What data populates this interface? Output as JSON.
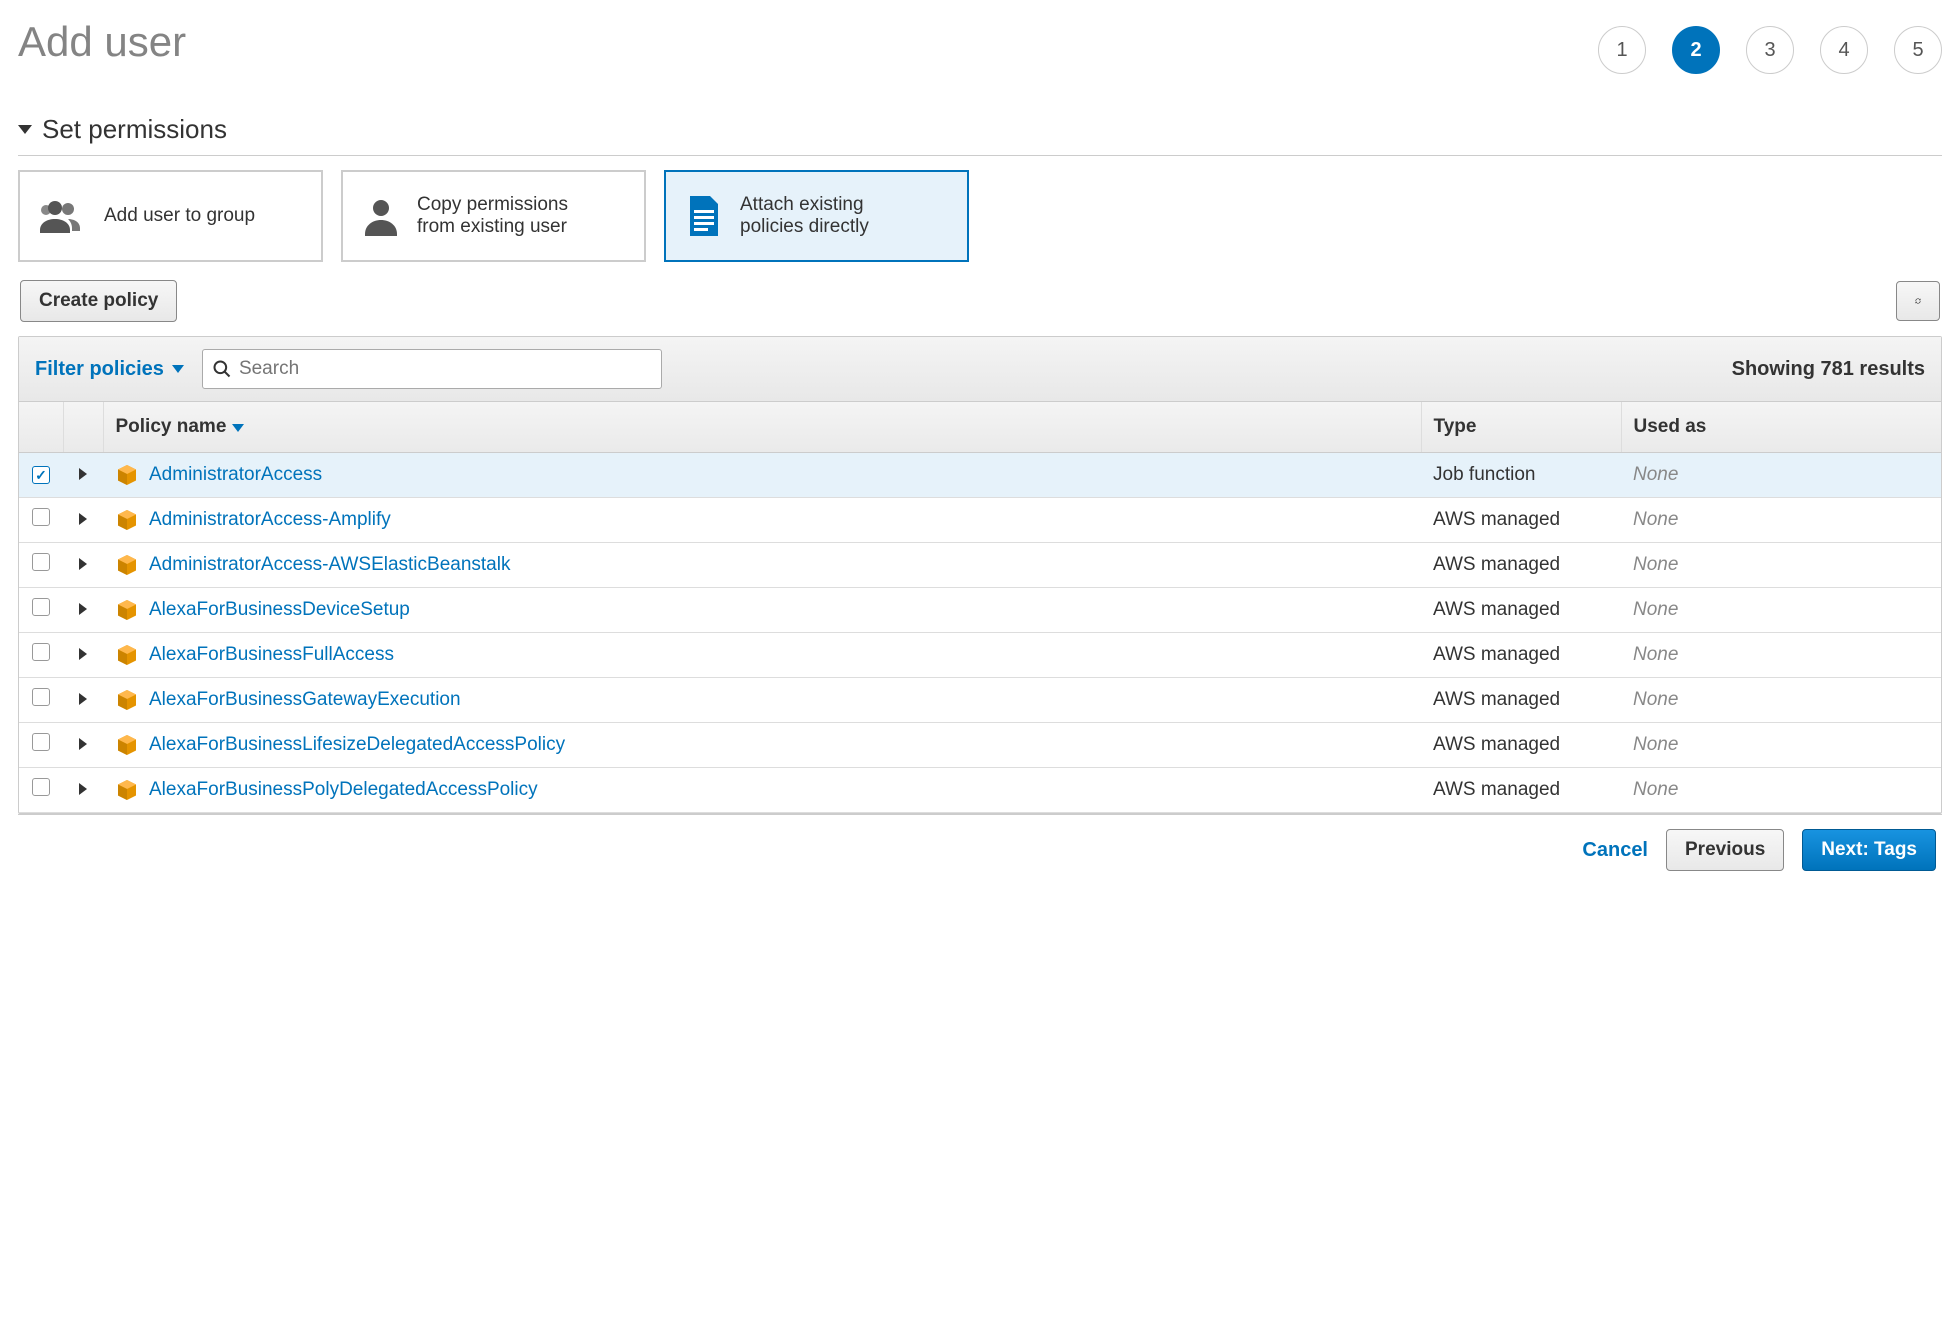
{
  "page": {
    "title": "Add user"
  },
  "stepper": {
    "steps": [
      "1",
      "2",
      "3",
      "4",
      "5"
    ],
    "active_index": 1
  },
  "section": {
    "title": "Set permissions"
  },
  "perm_options": {
    "add_group": "Add user to group",
    "copy": "Copy permissions from existing user",
    "attach": "Attach existing policies directly",
    "selected": "attach"
  },
  "toolbar": {
    "create_policy": "Create policy",
    "refresh_title": "Refresh"
  },
  "filter": {
    "filter_label": "Filter policies",
    "search_placeholder": "Search",
    "results_text": "Showing 781 results"
  },
  "columns": {
    "policy_name": "Policy name",
    "type": "Type",
    "used_as": "Used as"
  },
  "policies": [
    {
      "name": "AdministratorAccess",
      "type": "Job function",
      "used_as": "None",
      "checked": true
    },
    {
      "name": "AdministratorAccess-Amplify",
      "type": "AWS managed",
      "used_as": "None",
      "checked": false
    },
    {
      "name": "AdministratorAccess-AWSElasticBeanstalk",
      "type": "AWS managed",
      "used_as": "None",
      "checked": false
    },
    {
      "name": "AlexaForBusinessDeviceSetup",
      "type": "AWS managed",
      "used_as": "None",
      "checked": false
    },
    {
      "name": "AlexaForBusinessFullAccess",
      "type": "AWS managed",
      "used_as": "None",
      "checked": false
    },
    {
      "name": "AlexaForBusinessGatewayExecution",
      "type": "AWS managed",
      "used_as": "None",
      "checked": false
    },
    {
      "name": "AlexaForBusinessLifesizeDelegatedAccessPolicy",
      "type": "AWS managed",
      "used_as": "None",
      "checked": false
    },
    {
      "name": "AlexaForBusinessPolyDelegatedAccessPolicy",
      "type": "AWS managed",
      "used_as": "None",
      "checked": false
    }
  ],
  "footer": {
    "cancel": "Cancel",
    "previous": "Previous",
    "next": "Next: Tags"
  }
}
